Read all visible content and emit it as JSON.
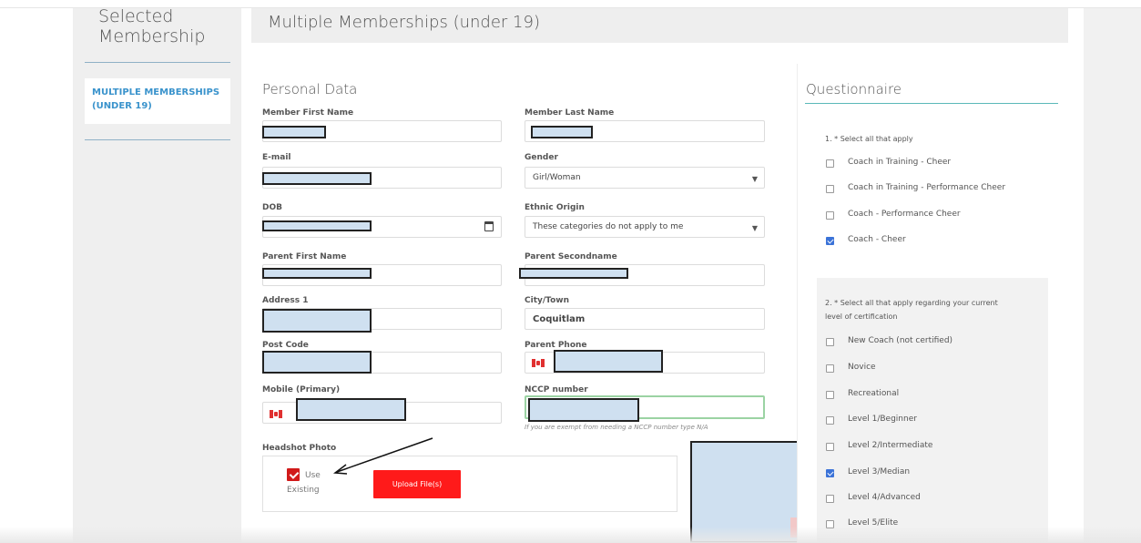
{
  "sidebar": {
    "title": "Selected Membership",
    "items": [
      {
        "label": "MULTIPLE MEMBERSHIPS (UNDER 19)"
      }
    ]
  },
  "header": {
    "title": "Multiple Memberships (under 19)"
  },
  "personal": {
    "section_title": "Personal Data",
    "fields": {
      "first_name": {
        "label": "Member First Name"
      },
      "last_name": {
        "label": "Member Last Name"
      },
      "email": {
        "label": "E-mail"
      },
      "gender": {
        "label": "Gender",
        "value": "Girl/Woman"
      },
      "dob": {
        "label": "DOB"
      },
      "ethnic": {
        "label": "Ethnic Origin",
        "value": "These categories do not apply to me"
      },
      "parent_first": {
        "label": "Parent First Name"
      },
      "parent_second": {
        "label": "Parent Secondname"
      },
      "address1": {
        "label": "Address 1"
      },
      "city": {
        "label": "City/Town",
        "value": "Coquitlam"
      },
      "post_code": {
        "label": "Post Code"
      },
      "parent_phone": {
        "label": "Parent Phone"
      },
      "mobile": {
        "label": "Mobile (Primary)"
      },
      "nccp": {
        "label": "NCCP number",
        "helper": "If you are exempt from needing a NCCP number type N/A"
      }
    },
    "headshot": {
      "label": "Headshot Photo",
      "use_existing_line1": "Use",
      "use_existing_line2": "Existing",
      "upload_label": "Upload File(s)"
    }
  },
  "questionnaire": {
    "title": "Questionnaire",
    "q1": {
      "prompt": "1. * Select all that apply",
      "options": [
        {
          "label": "Coach in Training - Cheer",
          "checked": false
        },
        {
          "label": "Coach in Training - Performance Cheer",
          "checked": false
        },
        {
          "label": "Coach - Performance Cheer",
          "checked": false
        },
        {
          "label": "Coach - Cheer",
          "checked": true
        }
      ]
    },
    "q2": {
      "prompt_line1": "2. * Select all that apply regarding your current",
      "prompt_line2": "level of certification",
      "options": [
        {
          "label": "New Coach (not certified)",
          "checked": false
        },
        {
          "label": "Novice",
          "checked": false
        },
        {
          "label": "Recreational",
          "checked": false
        },
        {
          "label": "Level 1/Beginner",
          "checked": false
        },
        {
          "label": "Level 2/Intermediate",
          "checked": false
        },
        {
          "label": "Level 3/Median",
          "checked": true
        },
        {
          "label": "Level 4/Advanced",
          "checked": false
        },
        {
          "label": "Level 5/Elite",
          "checked": false
        }
      ]
    }
  },
  "colors": {
    "accent_blue": "#3a93cc",
    "upload_red": "#ff1a1a",
    "check_blue": "#3b73d8",
    "teal_rule": "#5bb8b8"
  }
}
